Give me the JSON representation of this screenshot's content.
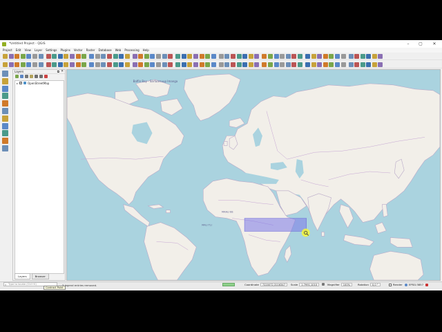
{
  "window": {
    "title": "*Untitled Project - QGIS",
    "controls": [
      "–",
      "▢",
      "✕"
    ]
  },
  "menu": [
    "Project",
    "Edit",
    "View",
    "Layer",
    "Settings",
    "Plugins",
    "Vector",
    "Raster",
    "Database",
    "Web",
    "Processing",
    "Help"
  ],
  "colors": {
    "ocean": "#aad3df",
    "land": "#f2efe9",
    "border": "#b28ec4",
    "selection": "#7b79e8",
    "highlight": "#f5f53a"
  },
  "layers_panel": {
    "title": "Layers",
    "float_glyph": "⧉",
    "close_glyph": "✕",
    "layers": [
      {
        "name": "OpenStreetMap",
        "checked": true,
        "expander": "▸",
        "check_glyph": "✓"
      }
    ],
    "tabs": [
      "Layers",
      "Browser"
    ]
  },
  "map_labels": {
    "baffin": "Baffin Bay - Sarfaarsuup Imanga",
    "tooltip": "Contract Point",
    "oceans": [
      "MALI TLI",
      "MAALI BE"
    ]
  },
  "statusbar": {
    "locator_placeholder": "Type to locate (Ctrl+K)",
    "locator_icon": "⌕",
    "message": "3 legend entries removed.",
    "coordinate_label": "Coordinate",
    "coordinate_value": "7220072,3116347",
    "scale_label": "Scale",
    "scale_value": "1:7991,1010",
    "magnifier_label": "Magnifier",
    "magnifier_value": "100%",
    "rotation_label": "Rotation",
    "rotation_value": "0,0 °",
    "render_label": "Render",
    "crs": "EPSG:3857"
  }
}
